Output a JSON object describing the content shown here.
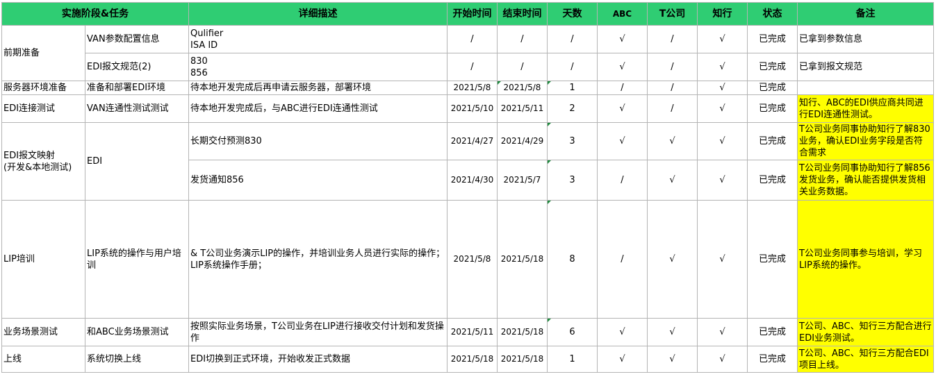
{
  "headers": {
    "phase": "实施阶段&任务",
    "desc": "详细描述",
    "start": "开始时间",
    "end": "结束时间",
    "days": "天数",
    "abc": "ABC",
    "tco": "T公司",
    "zx": "知行",
    "status": "状态",
    "note": "备注"
  },
  "rows": [
    {
      "phase": "前期准备",
      "task": "VAN参数配置信息",
      "desc_lines": [
        "Qulifier",
        "ISA ID"
      ],
      "start": "/",
      "end": "/",
      "days": "/",
      "abc": "√",
      "tco": "/",
      "zx": "√",
      "status": "已完成",
      "note": "已拿到参数信息"
    },
    {
      "task": "EDI报文规范(2)",
      "desc_lines": [
        "830",
        "856"
      ],
      "start": "/",
      "end": "/",
      "days": "/",
      "abc": "√",
      "tco": "/",
      "zx": "√",
      "status": "已完成",
      "note": "已拿到报文规范"
    },
    {
      "phase": "服务器环境准备",
      "task": "准备和部署EDI环境",
      "desc": "待本地开发完成后再申请云服务器，部署环境",
      "start": "2021/5/8",
      "end": "2021/5/8",
      "days": "1",
      "abc": "/",
      "tco": "/",
      "zx": "√",
      "status": "已完成",
      "note": ""
    },
    {
      "phase": "EDI连接测试",
      "task": "VAN连通性测试测试",
      "desc": "待本地开发完成后，与ABC进行EDI连通性测试",
      "start": "2021/5/10",
      "end": "2021/5/11",
      "days": "2",
      "abc": "√",
      "tco": "/",
      "zx": "√",
      "status": "已完成",
      "note": "知行、ABC的EDI供应商共同进行EDI连通性测试。"
    },
    {
      "phase_lines": [
        "EDI报文映射",
        "(开发&本地测试)"
      ],
      "task": "EDI",
      "desc": "长期交付预测830",
      "start": "2021/4/27",
      "end": "2021/4/29",
      "days": "3",
      "abc": "√",
      "tco": "√",
      "zx": "√",
      "status": "已完成",
      "note": "T公司业务同事协助知行了解830业务，确认EDI业务字段是否符合需求"
    },
    {
      "desc": "发货通知856",
      "start": "2021/4/30",
      "end": "2021/5/7",
      "days": "3",
      "abc": "/",
      "tco": "√",
      "zx": "√",
      "status": "已完成",
      "note": "T公司业务同事协助知行了解856发货业务，确认能否提供发货相关业务数据。"
    },
    {
      "phase": "LIP培训",
      "task": "LIP系统的操作与用户培训",
      "desc_lines": [
        "& T公司业务演示LIP的操作，并培训业务人员进行实际的操作；",
        "LIP系统操作手册；"
      ],
      "start": "2021/5/8",
      "end": "2021/5/18",
      "days": "8",
      "abc": "/",
      "tco": "√",
      "zx": "√",
      "status": "已完成",
      "note": "T公司业务同事参与培训，学习LIP系统的操作。"
    },
    {
      "phase": "业务场景测试",
      "task": "和ABC业务场景测试",
      "desc": "按照实际业务场景，T公司业务在LIP进行接收交付计划和发货操作",
      "start": "2021/5/11",
      "end": "2021/5/18",
      "days": "6",
      "abc": "√",
      "tco": "√",
      "zx": "√",
      "status": "已完成",
      "note": "T公司、ABC、知行三方配合进行EDI业务测试。"
    },
    {
      "phase": "上线",
      "task": "系统切换上线",
      "desc": "EDI切换到正式环境，开始收发正式数据",
      "start": "2021/5/18",
      "end": "2021/5/18",
      "days": "1",
      "abc": "√",
      "tco": "√",
      "zx": "√",
      "status": "已完成",
      "note": "T公司、ABC、知行三方配合EDI项目上线。"
    }
  ]
}
